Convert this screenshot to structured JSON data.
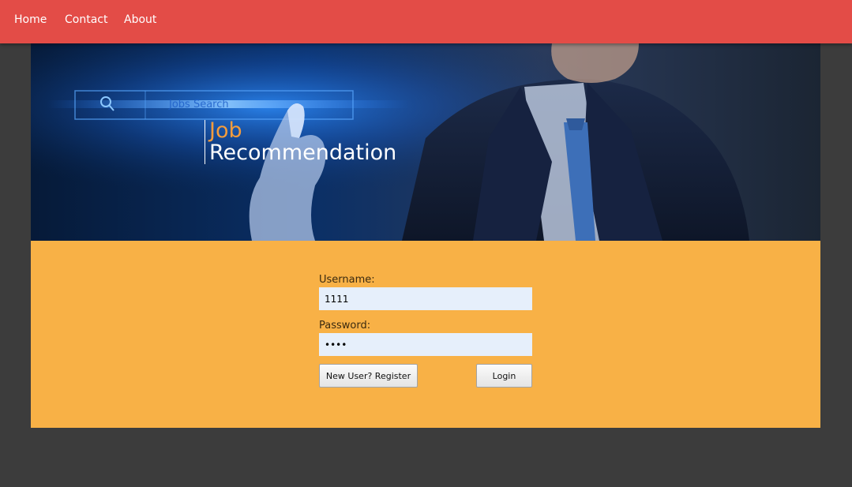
{
  "nav": {
    "items": [
      {
        "label": "Home"
      },
      {
        "label": "Contact"
      },
      {
        "label": "About"
      }
    ],
    "background_color": "#e34c47"
  },
  "banner": {
    "title_line1": "Job",
    "title_line2": "Recommendation",
    "search_bar_text": "Jobs Search",
    "accent_color": "#f39c3d"
  },
  "login": {
    "username_label": "Username:",
    "username_value": "1111",
    "password_label": "Password:",
    "password_value": "1234",
    "register_button": "New User? Register",
    "login_button": "Login",
    "panel_color": "#f8b146"
  }
}
